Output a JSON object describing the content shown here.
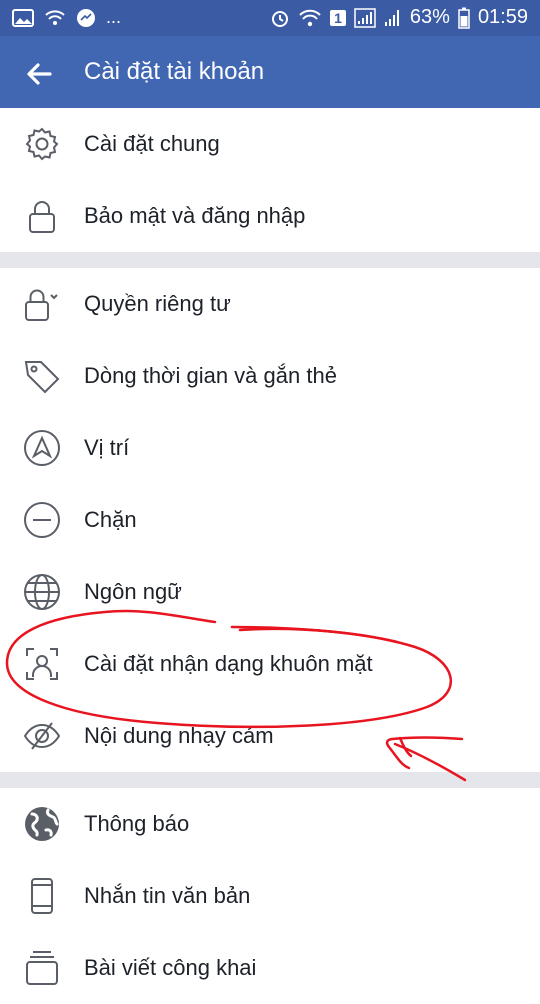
{
  "status_bar": {
    "battery": "63%",
    "time": "01:59",
    "sim": "1",
    "ellipsis": "..."
  },
  "header": {
    "title": "Cài đặt tài khoản"
  },
  "groups": [
    {
      "items": [
        {
          "label": "Cài đặt chung",
          "icon": "gear-icon"
        },
        {
          "label": "Bảo mật và đăng nhập",
          "icon": "lock-icon"
        }
      ]
    },
    {
      "items": [
        {
          "label": "Quyền riêng tư",
          "icon": "privacy-lock-icon"
        },
        {
          "label": "Dòng thời gian và gắn thẻ",
          "icon": "tag-icon"
        },
        {
          "label": "Vị trí",
          "icon": "location-arrow-icon"
        },
        {
          "label": "Chặn",
          "icon": "block-icon"
        },
        {
          "label": "Ngôn ngữ",
          "icon": "globe-icon"
        },
        {
          "label": "Cài đặt nhận dạng khuôn mặt",
          "icon": "face-recognition-icon"
        },
        {
          "label": "Nội dung nhạy cảm",
          "icon": "eye-slash-icon"
        }
      ]
    },
    {
      "items": [
        {
          "label": "Thông báo",
          "icon": "earth-icon"
        },
        {
          "label": "Nhắn tin văn bản",
          "icon": "phone-icon"
        },
        {
          "label": "Bài viết công khai",
          "icon": "feed-icon"
        }
      ]
    }
  ],
  "colors": {
    "status_bar": "#3b5ba5",
    "app_bar": "#4267b2",
    "divider": "#e4e6eb",
    "annotation": "#e8141f"
  }
}
